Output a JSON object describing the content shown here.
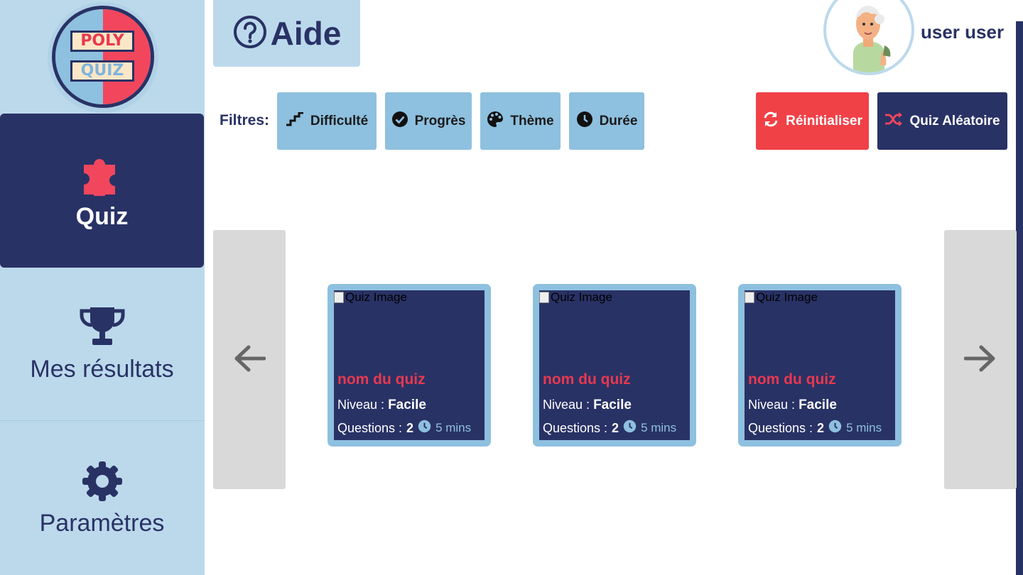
{
  "logo": {
    "line1": "POLY",
    "line2": "QUIZ"
  },
  "sidebar": {
    "items": [
      {
        "label": "Quiz",
        "icon": "puzzle-icon",
        "active": true
      },
      {
        "label": "Mes résultats",
        "icon": "trophy-icon",
        "active": false
      },
      {
        "label": "Paramètres",
        "icon": "gear-icon",
        "active": false
      }
    ]
  },
  "header": {
    "help_label": "Aide",
    "help_icon": "question-circle-icon",
    "username": "user user"
  },
  "filters": {
    "label": "Filtres:",
    "buttons": [
      {
        "label": "Difficulté",
        "icon": "stairs-icon"
      },
      {
        "label": "Progrès",
        "icon": "check-circle-icon"
      },
      {
        "label": "Thème",
        "icon": "palette-icon"
      },
      {
        "label": "Durée",
        "icon": "clock-icon"
      }
    ]
  },
  "actions": {
    "reset_label": "Réinitialiser",
    "random_label": "Quiz Aléatoire"
  },
  "carousel": {
    "cards": [
      {
        "image_alt": "Quiz Image",
        "title": "nom du quiz",
        "level_label": "Niveau :",
        "level": "Facile",
        "questions_label": "Questions :",
        "questions": "2",
        "duration": "5 mins"
      },
      {
        "image_alt": "Quiz Image",
        "title": "nom du quiz",
        "level_label": "Niveau :",
        "level": "Facile",
        "questions_label": "Questions :",
        "questions": "2",
        "duration": "5 mins"
      },
      {
        "image_alt": "Quiz Image",
        "title": "nom du quiz",
        "level_label": "Niveau :",
        "level": "Facile",
        "questions_label": "Questions :",
        "questions": "2",
        "duration": "5 mins"
      }
    ]
  },
  "colors": {
    "navy": "#293265",
    "light_blue": "#bcd9ec",
    "mid_blue": "#8ec0df",
    "red": "#f04147",
    "accent_red": "#e9384f",
    "grey": "#d9d9d9"
  }
}
